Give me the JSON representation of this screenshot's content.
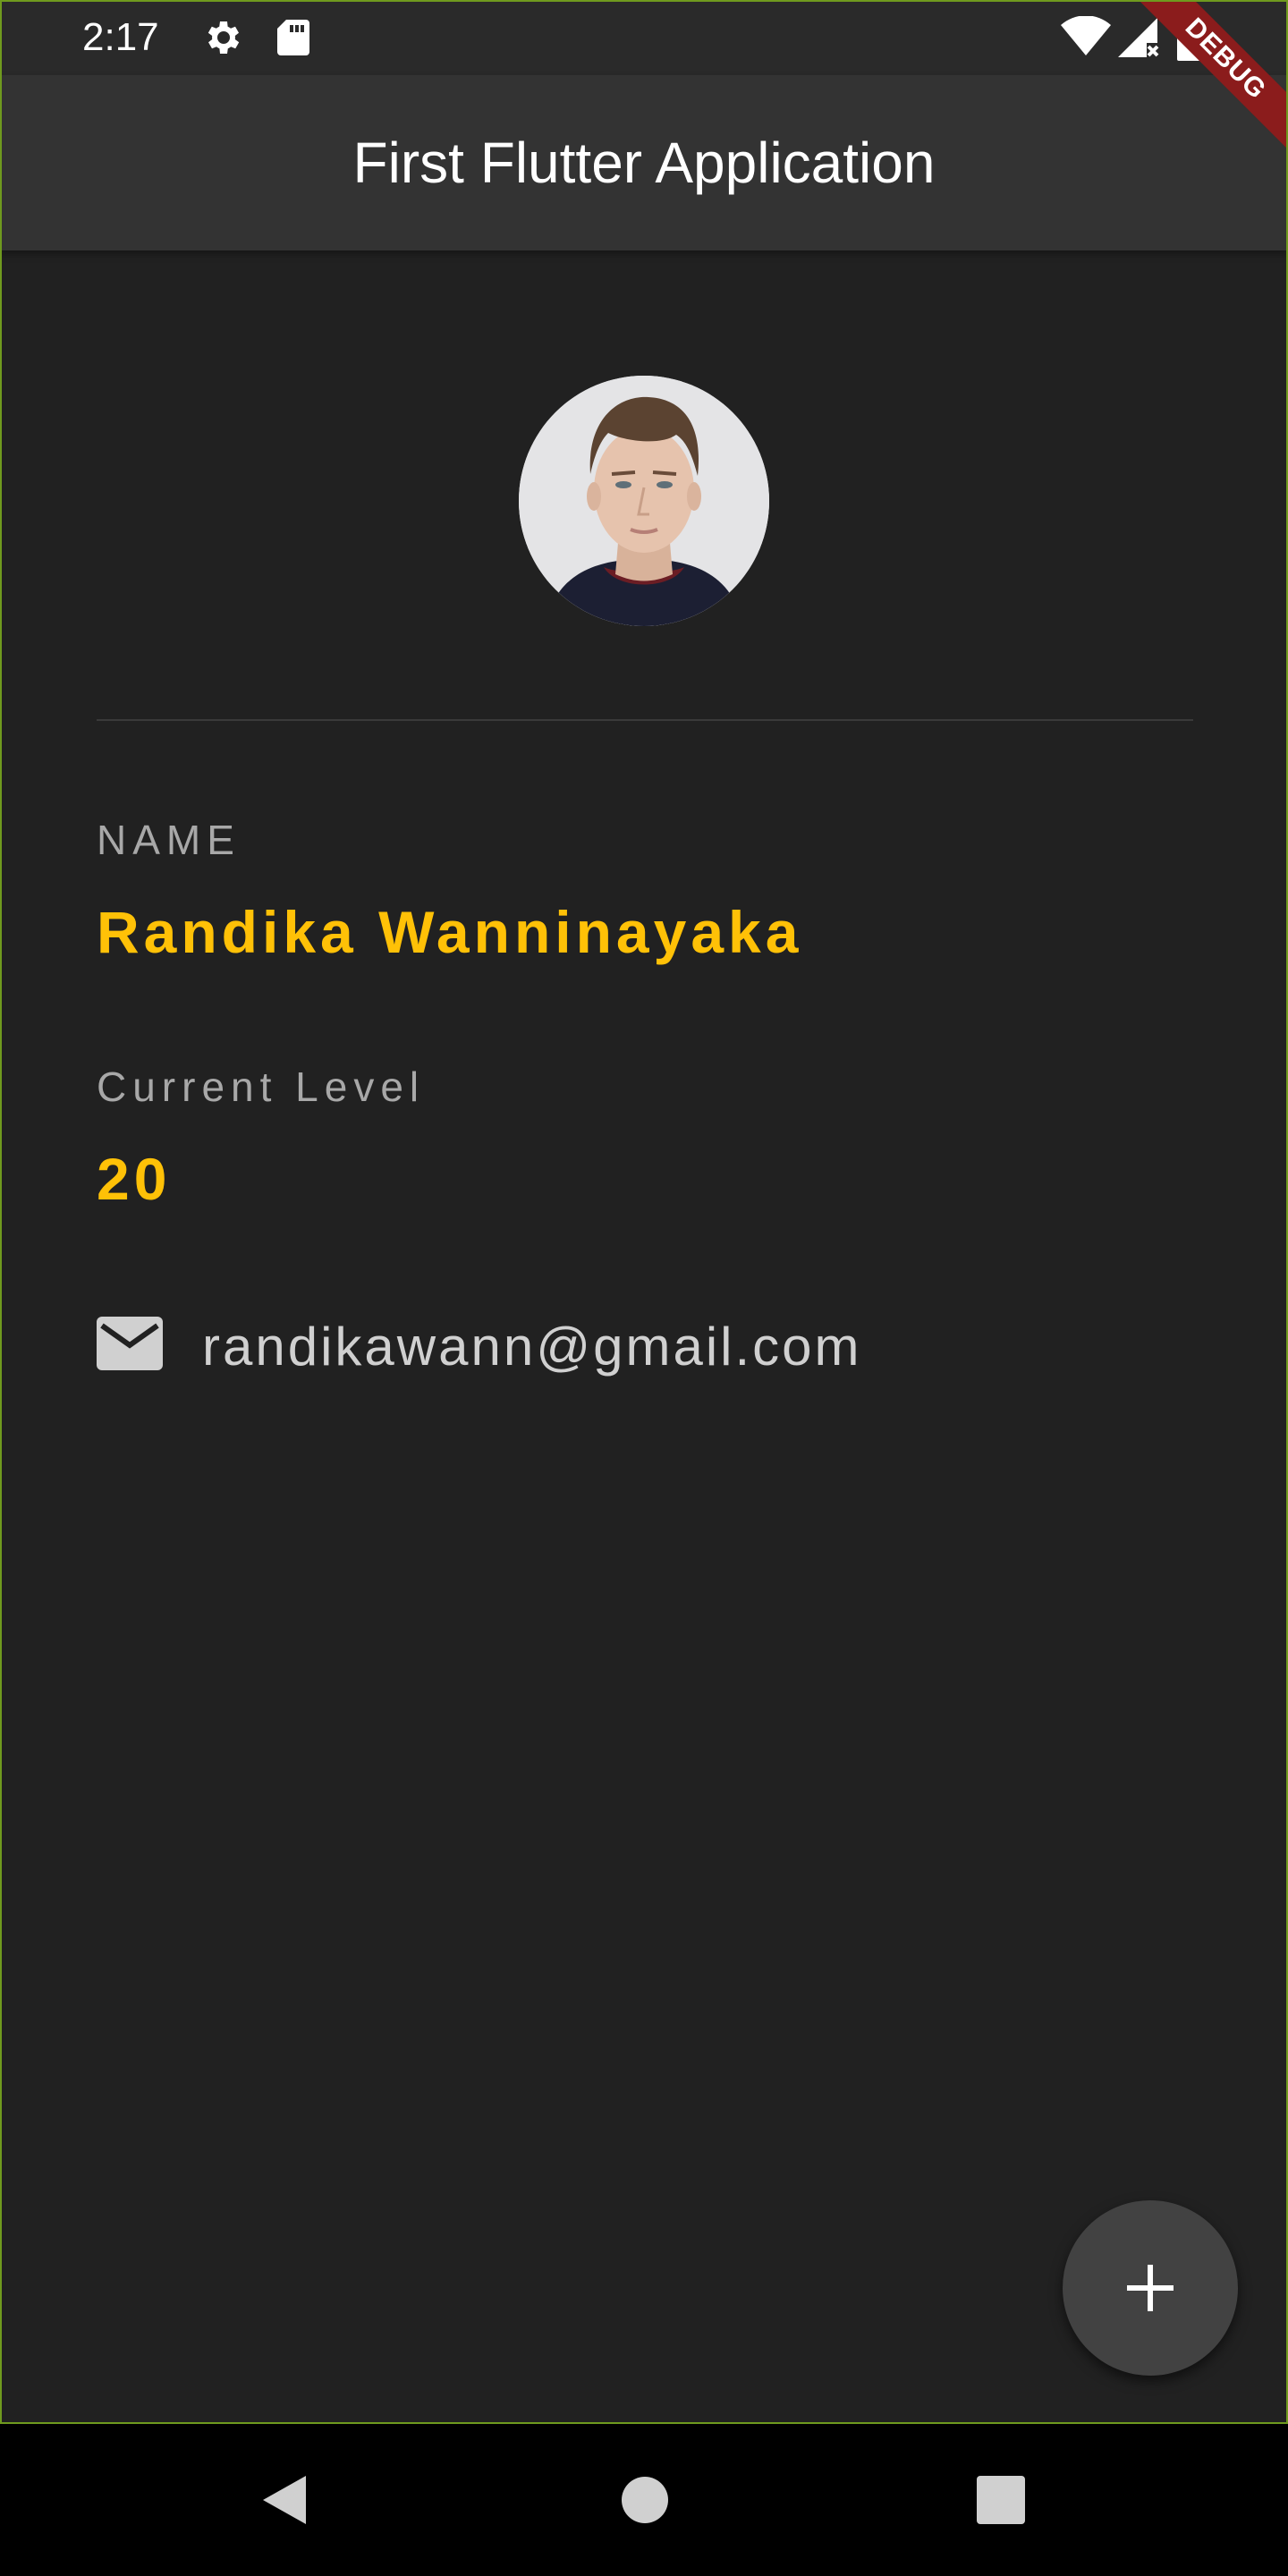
{
  "status_bar": {
    "time": "2:17",
    "icons": [
      "gear-icon",
      "sd-card-icon",
      "wifi-icon",
      "cell-signal-icon",
      "battery-icon"
    ]
  },
  "app_bar": {
    "title": "First Flutter Application"
  },
  "debug_banner": {
    "text": "DEBUG",
    "color": "#8b1c1c"
  },
  "profile": {
    "name_label": "NAME",
    "name_value": "Randika Wanninayaka",
    "level_label": "Current Level",
    "level_value": "20",
    "email": "randikawann@gmail.com",
    "email_icon": "mail-icon"
  },
  "fab": {
    "icon": "plus-icon"
  },
  "nav_bar": {
    "icons": [
      "back-icon",
      "home-icon",
      "recents-icon"
    ]
  },
  "colors": {
    "background": "#212121",
    "app_bar": "#333333",
    "accent": "#ffc107",
    "label": "#a8a8a8",
    "fab": "#424242",
    "frame_border": "#6f9a1e"
  }
}
